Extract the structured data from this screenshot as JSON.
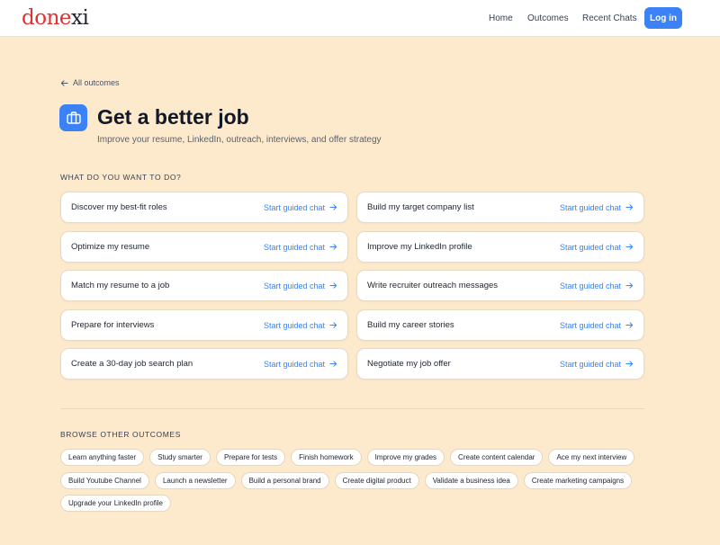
{
  "header": {
    "logo": {
      "main": "done",
      "accent": "xi"
    },
    "nav": {
      "home": "Home",
      "outcomes": "Outcomes",
      "recent_chats": "Recent Chats"
    },
    "login_label": "Log in"
  },
  "back_link": "All outcomes",
  "page": {
    "icon": "briefcase-icon",
    "title": "Get a better job",
    "subtitle": "Improve your resume, LinkedIn, outreach, interviews, and offer strategy"
  },
  "actions": {
    "heading": "WHAT DO YOU WANT TO DO?",
    "cta_label": "Start guided chat",
    "items": [
      "Discover my best-fit roles",
      "Build my target company list",
      "Optimize my resume",
      "Improve my LinkedIn profile",
      "Match my resume to a job",
      "Write recruiter outreach messages",
      "Prepare for interviews",
      "Build my career stories",
      "Create a 30-day job search plan",
      "Negotiate my job offer"
    ]
  },
  "browse": {
    "heading": "BROWSE OTHER OUTCOMES",
    "chips": [
      "Learn anything faster",
      "Study smarter",
      "Prepare for tests",
      "Finish homework",
      "Improve my grades",
      "Create content calendar",
      "Ace my next interview",
      "Build Youtube Channel",
      "Launch a newsletter",
      "Build a personal brand",
      "Create digital product",
      "Validate a business idea",
      "Create marketing campaigns",
      "Upgrade your LinkedIn profile"
    ]
  },
  "colors": {
    "background": "#fde9cc",
    "accent": "#3b82f6",
    "logo_red": "#e03131"
  }
}
